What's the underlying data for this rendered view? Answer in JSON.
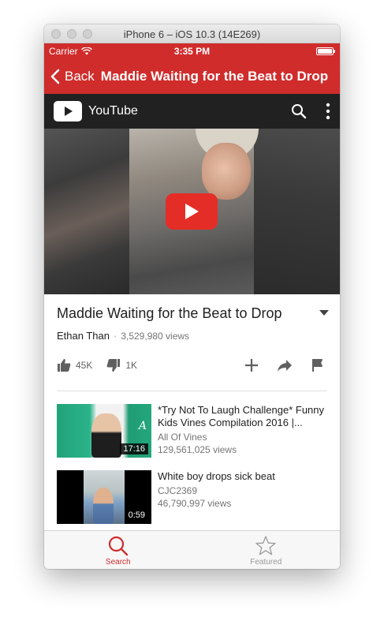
{
  "window": {
    "title": "iPhone 6 – iOS 10.3 (14E269)"
  },
  "status_bar": {
    "carrier": "Carrier",
    "time": "3:35 PM"
  },
  "nav_bar": {
    "back_label": "Back",
    "title": "Maddie Waiting for the Beat to Drop"
  },
  "youtube": {
    "brand": "YouTube",
    "video": {
      "title": "Maddie Waiting for the Beat to Drop",
      "channel": "Ethan Than",
      "separator": "·",
      "views": "3,529,980 views",
      "likes": "45K",
      "dislikes": "1K"
    },
    "related": [
      {
        "title": "*Try Not To Laugh Challenge* Funny Kids Vines Compilation 2016 |...",
        "channel": "All Of Vines",
        "views": "129,561,025 views",
        "duration": "17:16"
      },
      {
        "title": "White boy drops sick beat",
        "channel": "CJC2369",
        "views": "46,790,997 views",
        "duration": "0:59"
      }
    ]
  },
  "tab_bar": {
    "tabs": [
      {
        "label": "Search",
        "icon": "search-icon"
      },
      {
        "label": "Featured",
        "icon": "star-icon"
      }
    ]
  },
  "colors": {
    "brand_red": "#d02c2c",
    "youtube_red": "#e52d27",
    "youtube_header": "#212121"
  }
}
